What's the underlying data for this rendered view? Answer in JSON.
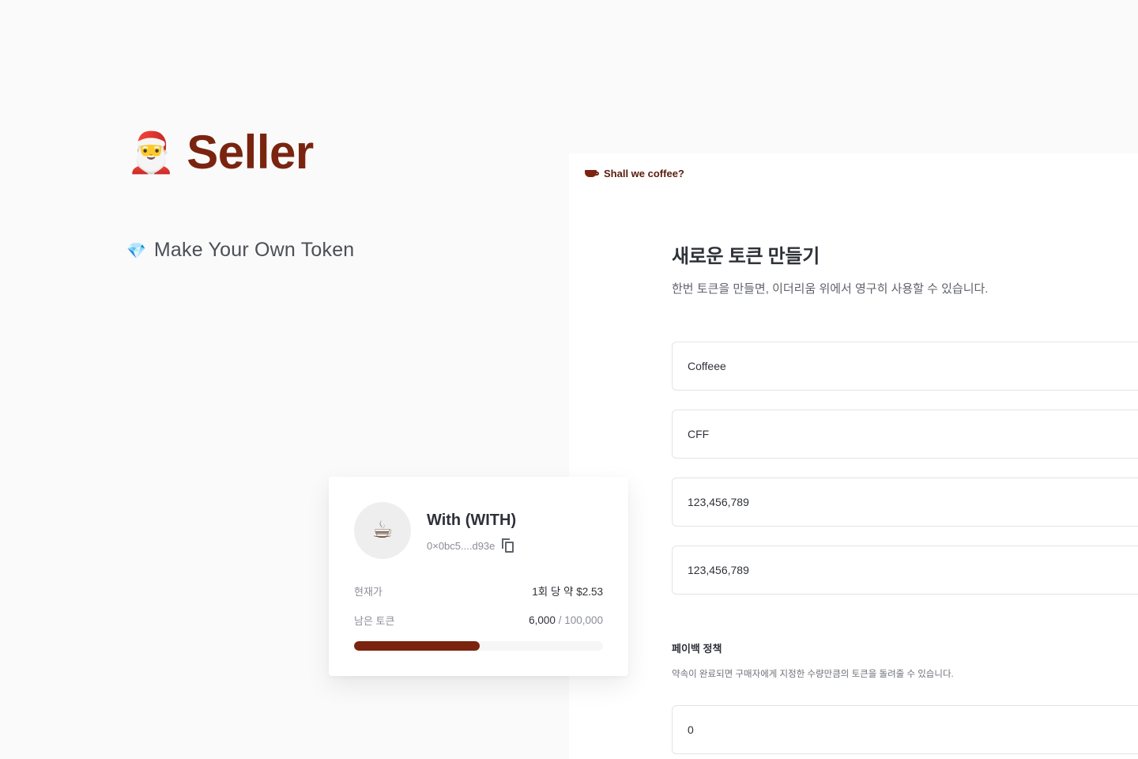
{
  "hero": {
    "emoji": "🎅",
    "title": "Seller",
    "subtitle_icon": "💎",
    "subtitle": "Make Your Own Token"
  },
  "panel": {
    "brand_name": "Shall we coffee?",
    "title": "새로운 토큰 만들기",
    "description": "한번 토큰을 만들면, 이더리움 위에서 영구히 사용할 수 있습니다.",
    "fields": {
      "token_name": "Coffeee",
      "token_symbol": "CFF",
      "total_supply": "123,456,789",
      "amount": "123,456,789"
    },
    "payback": {
      "title": "페이백 정책",
      "description": "약속이 완료되면 구매자에게 지정한 수량만큼의 토큰을 돌려줄 수 있습니다.",
      "value": "0"
    }
  },
  "token_card": {
    "icon": "☕",
    "name": "With (WITH)",
    "address": "0×0bc5....d93e",
    "price_label": "현재가",
    "price_value": "1회 당 약 $2.53",
    "remaining_label": "남은 토큰",
    "remaining_value": "6,000",
    "remaining_total": "/ 100,000",
    "progress_fraction": 0.505
  },
  "colors": {
    "brand": "#7a2410",
    "background": "#fafafa",
    "panel": "#ffffff"
  },
  "icons": [
    "santa-emoji",
    "gem-icon",
    "coffee-cup-icon",
    "copy-icon"
  ]
}
